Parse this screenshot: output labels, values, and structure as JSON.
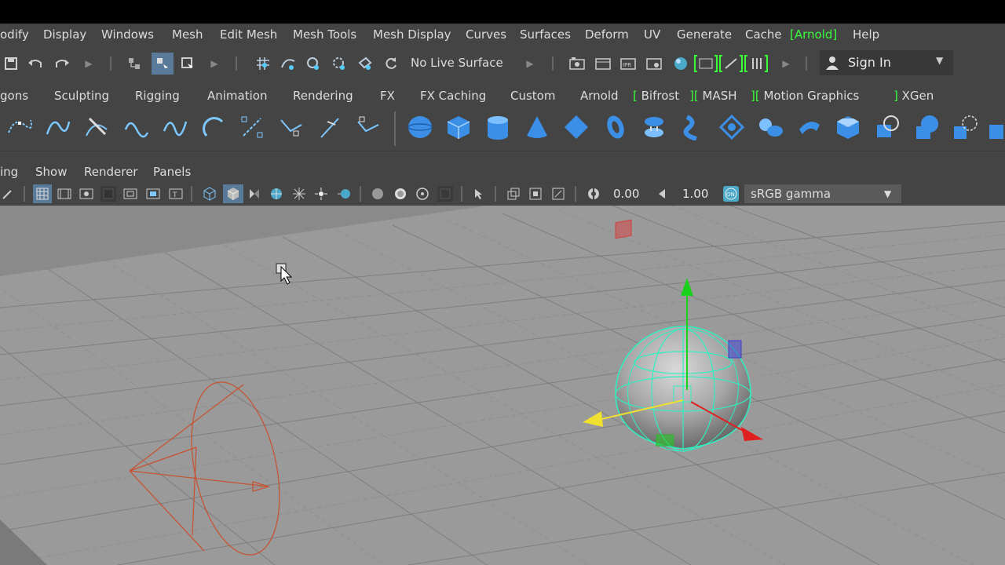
{
  "menubar": {
    "items": [
      "odify",
      "Display",
      "Windows",
      "Mesh",
      "Edit Mesh",
      "Mesh Tools",
      "Mesh Display",
      "Curves",
      "Surfaces",
      "Deform",
      "UV",
      "Generate",
      "Cache"
    ],
    "arnold": "Arnold",
    "help": "Help"
  },
  "statusline": {
    "live_surface": "No Live Surface",
    "sign_in": "Sign In"
  },
  "shelf_tabs": [
    "gons",
    "Sculpting",
    "Rigging",
    "Animation",
    "Rendering",
    "FX",
    "FX Caching",
    "Custom",
    "Arnold",
    "Bifrost",
    "MASH",
    "Motion Graphics",
    "XGen"
  ],
  "panel_menu": [
    "ing",
    "Show",
    "Renderer",
    "Panels"
  ],
  "viewport_toolbar": {
    "exposure": "0.00",
    "gamma": "1.00",
    "color_space": "sRGB gamma"
  },
  "colors": {
    "accent_green": "#39ff39",
    "selection_cyan": "#2ef0c0",
    "camera_red": "#c8502e",
    "grid_bg": "#9a9a9a"
  }
}
